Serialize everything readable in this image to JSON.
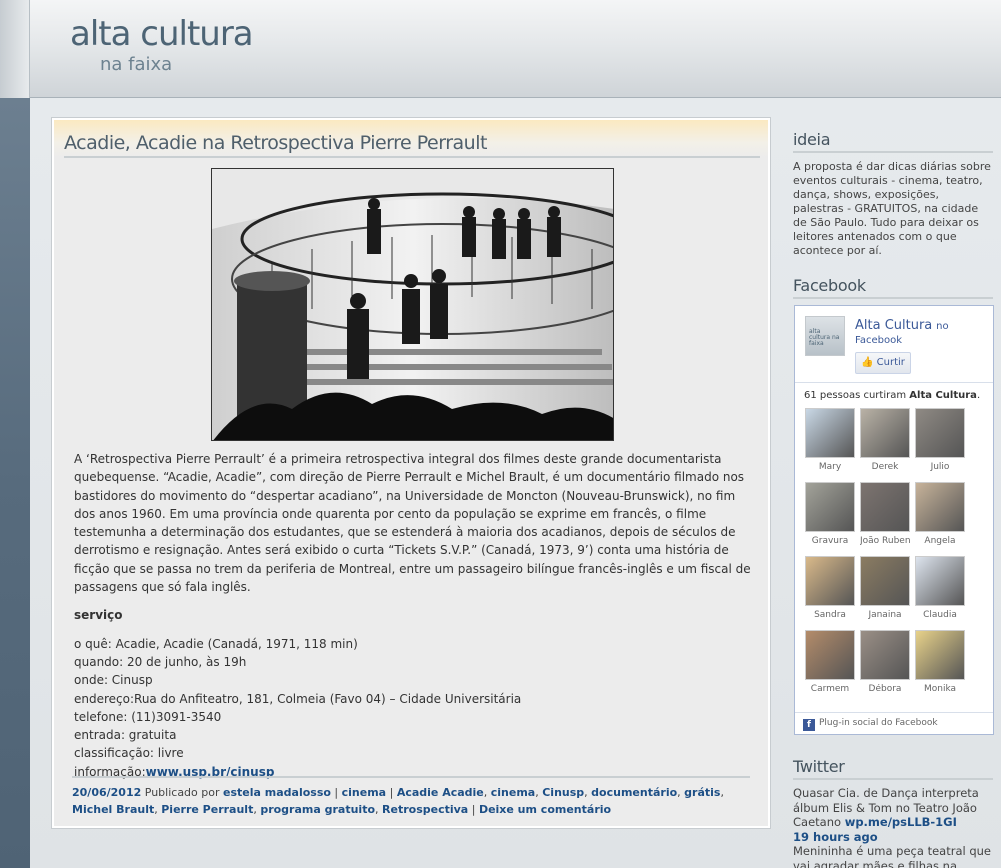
{
  "header": {
    "site_title": "alta cultura",
    "tagline": "na faixa"
  },
  "post": {
    "title": "Acadie, Acadie na Retrospectiva Pierre Perrault",
    "paragraph": "A ‘Retrospectiva Pierre Perrault’ é a primeira retrospectiva integral dos filmes deste grande documentarista quebequense. “Acadie, Acadie”, com direção de Pierre Perrault e Michel Brault, é um documentário filmado nos bastidores do movimento do “despertar acadiano”, na Universidade de Moncton (Nouveau-Brunswick), no fim dos anos 1960. Em uma província onde quarenta por cento da população se exprime em francês, o filme testemunha a determinação dos estudantes, que se estenderá à maioria dos acadianos, depois de séculos de derrotismo e resignação. Antes será exibido o curta “Tickets S.V.P.” (Canadá, 1973, 9’) conta uma história de ficção que se passa no trem da periferia de Montreal, entre um passageiro bilíngue francês-inglês e um fiscal de passagens que só fala inglês.",
    "service_heading": "serviço",
    "details": [
      "o quê: Acadie, Acadie (Canadá, 1971, 118 min)",
      "quando: 20 de junho, às 19h",
      "onde: Cinusp",
      "endereço:Rua do Anfiteatro, 181, Colmeia (Favo 04) – Cidade Universitária",
      "telefone: (11)3091-3540",
      "entrada: gratuita",
      "classificação: livre"
    ],
    "info_label": "informação:",
    "info_link": "www.usp.br/cinusp",
    "meta": {
      "date": "20/06/2012",
      "published_by": "Publicado por",
      "author": "estela madalosso",
      "category": "cinema",
      "tags": [
        "Acadie Acadie",
        "cinema",
        "Cinusp",
        "documentário",
        "grátis",
        "Michel Brault",
        "Pierre Perrault",
        "programa gratuito",
        "Retrospectiva"
      ],
      "comment_link": "Deixe um comentário"
    }
  },
  "sidebar": {
    "ideia": {
      "title": "ideia",
      "text": "A proposta é dar dicas diárias sobre eventos culturais - cinema, teatro, dança, shows, exposições, palestras - GRATUITOS, na cidade de São Paulo. Tudo para deixar os leitores antenados com o que acontece por aí."
    },
    "facebook": {
      "title": "Facebook",
      "logo_text": "alta cultura na faixa",
      "page_name": "Alta Cultura",
      "page_suffix": "no",
      "page_suffix2": "Facebook",
      "like_button": "Curtir",
      "count_prefix": "61 pessoas curtiram",
      "count_name": "Alta Cultura",
      "count_suffix": ".",
      "fans": [
        "Mary",
        "Derek",
        "Julio",
        "Gravura",
        "João Rubens",
        "Angela",
        "Sandra",
        "Janaina",
        "Claudia",
        "Carmem",
        "Débora",
        "Monika"
      ],
      "footer": "Plug-in social do Facebook"
    },
    "twitter": {
      "title": "Twitter",
      "tweet": "Quasar Cia. de Dança interpreta álbum Elis & Tom no Teatro João Caetano",
      "tweet_link": "wp.me/psLLB-1GI",
      "tweet_time": "19 hours ago",
      "tweet2": "Menininha é uma peça teatral que vai agradar mães e filhas na"
    }
  },
  "colors": {
    "link": "#1d4f86",
    "title_bar": "#fbe9c1",
    "facebook": "#3b5998"
  }
}
